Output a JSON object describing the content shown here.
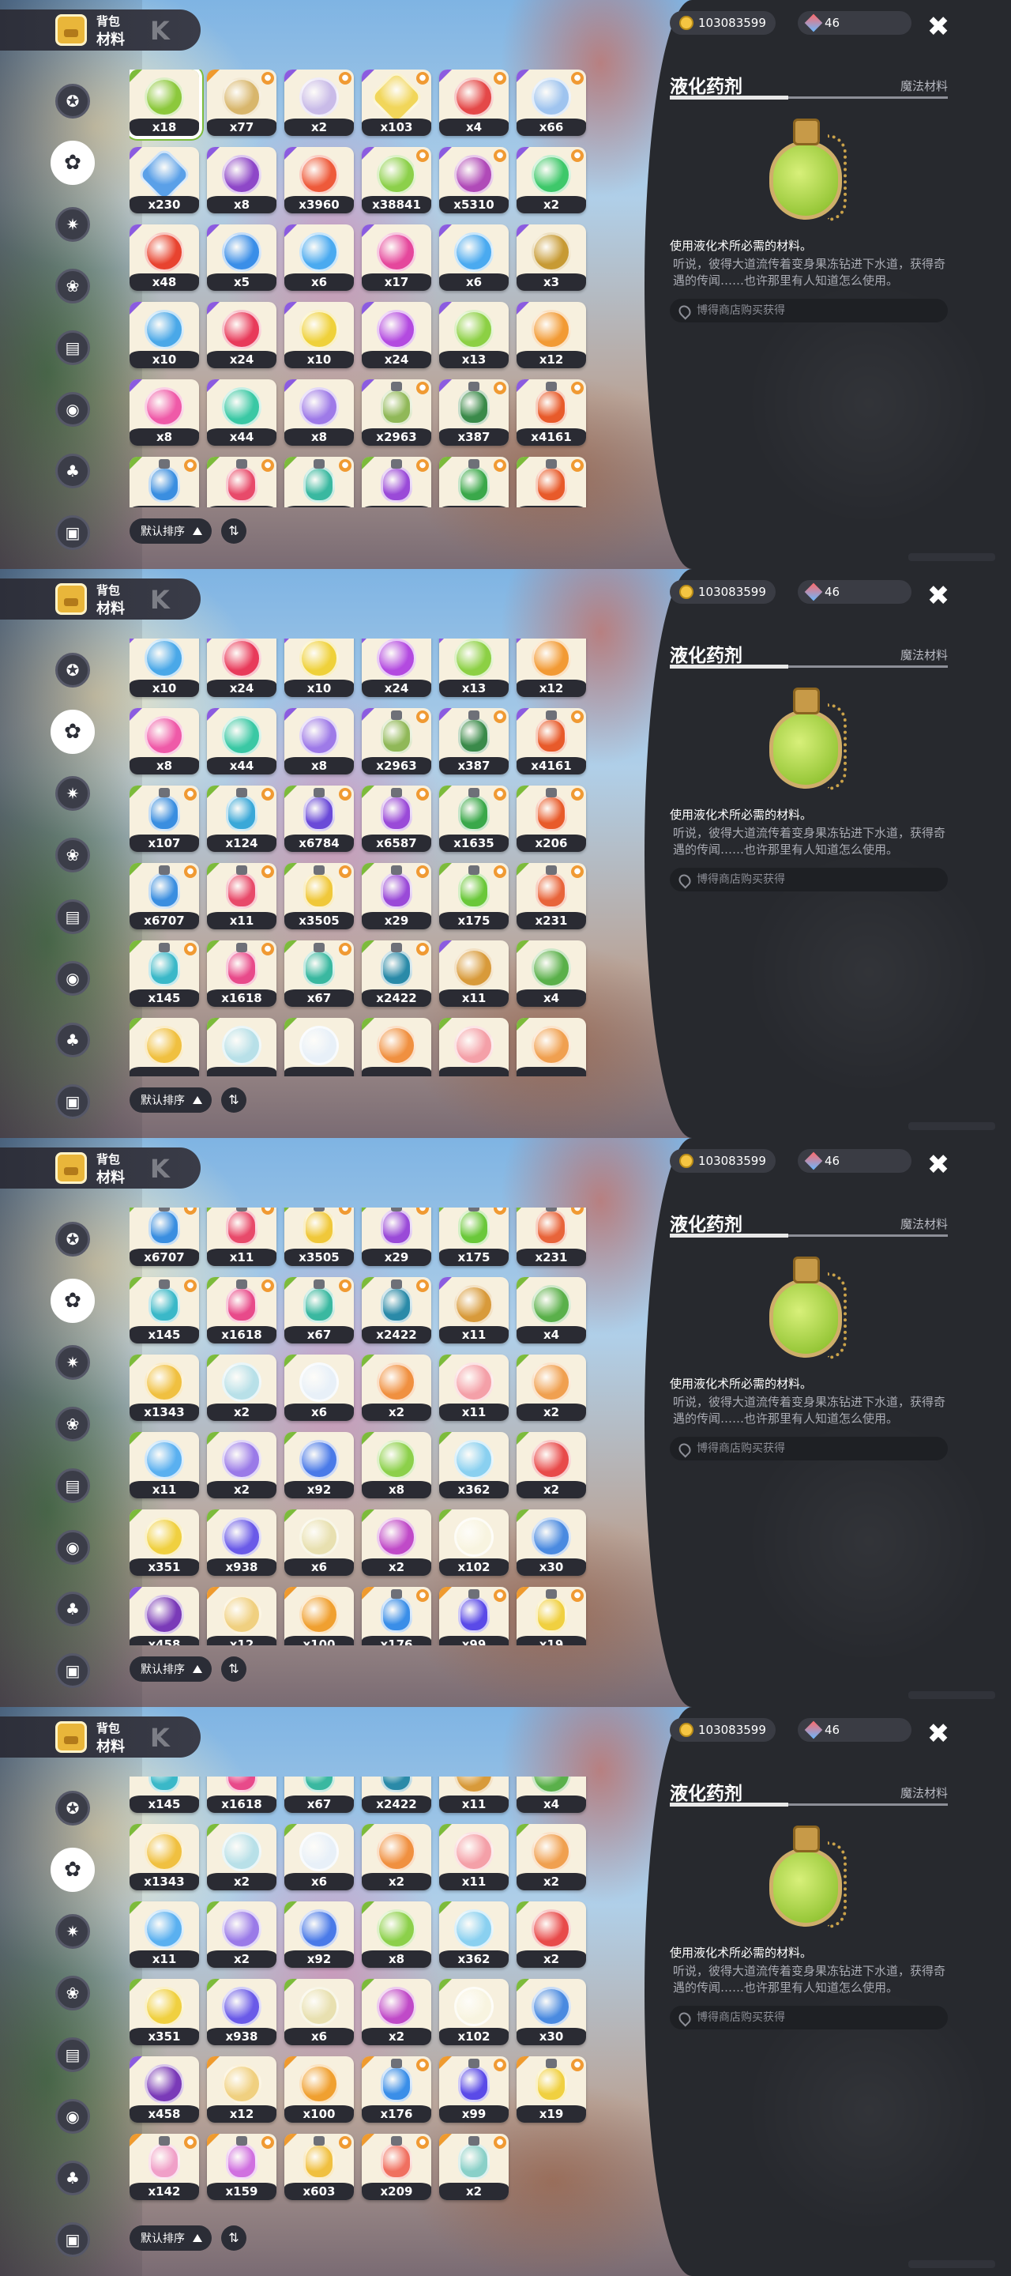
{
  "header": {
    "line1": "背包",
    "line2": "材料",
    "deco": "K"
  },
  "currency": {
    "coins": "103083599",
    "gems": "46"
  },
  "detail": {
    "title": "液化药剂",
    "category": "魔法材料",
    "use": "使用液化术所必需的材料。",
    "flavor": "听说，彼得大道流传着变身果冻钻进下水道，获得奇遇的传闻……也许那里有人知道怎么使用。",
    "source": "博得商店购买获得"
  },
  "sort": {
    "label": "默认排序",
    "toggle": "⇅"
  },
  "colors": {
    "rare_green": "#7cbb3b",
    "rare_purple": "#8b5be0",
    "rare_orange": "#ef9a2e",
    "new_badge": "#f09a33"
  },
  "sidebar": [
    "star-icon",
    "leaf-icon",
    "gear-star-icon",
    "flower-icon",
    "cart-icon",
    "ball-icon",
    "acorn-icon",
    "chest-icon"
  ],
  "panels": [
    {
      "active_sidebar": 1,
      "rows": [
        [
          [
            "x18",
            "#8cc83c",
            "g",
            0,
            "round"
          ],
          [
            "x77",
            "#d8b66c",
            "o",
            1,
            "round"
          ],
          [
            "x2",
            "#c9bbe8",
            "p",
            1,
            "round"
          ],
          [
            "x103",
            "#f1d65a",
            "p",
            1,
            "sq"
          ],
          [
            "x4",
            "#e44848",
            "p",
            1,
            "round"
          ],
          [
            "x66",
            "#9fc4ef",
            "p",
            1,
            "round"
          ]
        ],
        [
          [
            "x230",
            "#5aa0e8",
            "p",
            0,
            "sq"
          ],
          [
            "x8",
            "#8e47c8",
            "p",
            0,
            "round"
          ],
          [
            "x3960",
            "#ee5a3a",
            "p",
            0,
            "round"
          ],
          [
            "x38841",
            "#8cd04a",
            "p",
            1,
            "round"
          ],
          [
            "x5310",
            "#b04ab8",
            "p",
            1,
            "round"
          ],
          [
            "x2",
            "#3ec86a",
            "p",
            1,
            "round"
          ]
        ],
        [
          [
            "x48",
            "#e8432f",
            "p",
            0,
            "round"
          ],
          [
            "x5",
            "#3a8ee8",
            "p",
            0,
            "round"
          ],
          [
            "x6",
            "#4aaaf0",
            "p",
            0,
            "round"
          ],
          [
            "x17",
            "#e5479c",
            "p",
            0,
            "round"
          ],
          [
            "x6",
            "#4aaaf0",
            "p",
            0,
            "round"
          ],
          [
            "x3",
            "#c79a34",
            "p",
            0,
            "round"
          ]
        ],
        [
          [
            "x10",
            "#4aa8e8",
            "p",
            0,
            "round"
          ],
          [
            "x24",
            "#e83a5a",
            "p",
            0,
            "round"
          ],
          [
            "x10",
            "#efd13a",
            "p",
            0,
            "round"
          ],
          [
            "x24",
            "#b34ae0",
            "p",
            0,
            "round"
          ],
          [
            "x13",
            "#8cd044",
            "p",
            0,
            "round"
          ],
          [
            "x12",
            "#f29a34",
            "p",
            0,
            "round"
          ]
        ],
        [
          [
            "x8",
            "#ef5aa8",
            "p",
            0,
            "round"
          ],
          [
            "x44",
            "#3ac8a4",
            "p",
            0,
            "round"
          ],
          [
            "x8",
            "#9e7ae8",
            "p",
            0,
            "round"
          ],
          [
            "x2963",
            "#90b858",
            "p",
            1,
            "bottle"
          ],
          [
            "x387",
            "#3a8a4a",
            "p",
            1,
            "bottle"
          ],
          [
            "x4161",
            "#e85a2a",
            "p",
            1,
            "bottle"
          ]
        ],
        [
          [
            "",
            "#3a8ee0",
            "g",
            1,
            "bottle"
          ],
          [
            "",
            "#e84a6a",
            "g",
            1,
            "bottle"
          ],
          [
            "",
            "#3ab8a0",
            "g",
            1,
            "bottle"
          ],
          [
            "",
            "#9a4ad8",
            "g",
            1,
            "bottle"
          ],
          [
            "",
            "#3aa84a",
            "g",
            1,
            "bottle"
          ],
          [
            "",
            "#e85a2a",
            "g",
            1,
            "bottle"
          ]
        ]
      ]
    },
    {
      "active_sidebar": 1,
      "rows": [
        [
          [
            "x10",
            "#4aa8e8",
            "p",
            0,
            "round"
          ],
          [
            "x24",
            "#e83a5a",
            "p",
            0,
            "round"
          ],
          [
            "x10",
            "#efd13a",
            "p",
            0,
            "round"
          ],
          [
            "x24",
            "#b34ae0",
            "p",
            0,
            "round"
          ],
          [
            "x13",
            "#8cd044",
            "p",
            0,
            "round"
          ],
          [
            "x12",
            "#f29a34",
            "p",
            0,
            "round"
          ]
        ],
        [
          [
            "x8",
            "#ef5aa8",
            "p",
            0,
            "round"
          ],
          [
            "x44",
            "#3ac8a4",
            "p",
            0,
            "round"
          ],
          [
            "x8",
            "#9e7ae8",
            "p",
            0,
            "round"
          ],
          [
            "x2963",
            "#90b858",
            "p",
            1,
            "bottle"
          ],
          [
            "x387",
            "#3a8a4a",
            "p",
            1,
            "bottle"
          ],
          [
            "x4161",
            "#e85a2a",
            "p",
            1,
            "bottle"
          ]
        ],
        [
          [
            "x107",
            "#3a8ee0",
            "g",
            1,
            "bottle"
          ],
          [
            "x124",
            "#3aa8d8",
            "g",
            1,
            "bottle"
          ],
          [
            "x6784",
            "#6a4ad8",
            "g",
            1,
            "bottle"
          ],
          [
            "x6587",
            "#9a4ad8",
            "g",
            1,
            "bottle"
          ],
          [
            "x1635",
            "#3aa84a",
            "g",
            1,
            "bottle"
          ],
          [
            "x206",
            "#e85a2a",
            "g",
            1,
            "bottle"
          ]
        ],
        [
          [
            "x6707",
            "#3a8ee0",
            "g",
            1,
            "bottle"
          ],
          [
            "x11",
            "#e84a6a",
            "g",
            1,
            "bottle"
          ],
          [
            "x3505",
            "#f0c83a",
            "g",
            1,
            "bottle"
          ],
          [
            "x29",
            "#9a4ad8",
            "g",
            1,
            "bottle"
          ],
          [
            "x175",
            "#6ac83a",
            "g",
            1,
            "bottle"
          ],
          [
            "x231",
            "#e8643a",
            "g",
            1,
            "bottle"
          ]
        ],
        [
          [
            "x145",
            "#3ab8c8",
            "g",
            1,
            "bottle"
          ],
          [
            "x1618",
            "#e84a8a",
            "g",
            1,
            "bottle"
          ],
          [
            "x67",
            "#3ab8a0",
            "g",
            1,
            "bottle"
          ],
          [
            "x2422",
            "#2a8aa8",
            "g",
            1,
            "bottle"
          ],
          [
            "x11",
            "#d89a3a",
            "p",
            0,
            "round"
          ],
          [
            "x4",
            "#5ab04a",
            "g",
            0,
            "round"
          ]
        ],
        [
          [
            "",
            "#f0c040",
            "g",
            0,
            "round"
          ],
          [
            "",
            "#b8e0e8",
            "g",
            0,
            "round"
          ],
          [
            "",
            "#e8f0f8",
            "g",
            0,
            "round"
          ],
          [
            "",
            "#f09040",
            "g",
            0,
            "round"
          ],
          [
            "",
            "#f4a0a8",
            "g",
            0,
            "round"
          ],
          [
            "",
            "#f0a050",
            "g",
            0,
            "round"
          ]
        ]
      ]
    },
    {
      "active_sidebar": 1,
      "rows": [
        [
          [
            "x6707",
            "#3a8ee0",
            "g",
            1,
            "bottle"
          ],
          [
            "x11",
            "#e84a6a",
            "g",
            1,
            "bottle"
          ],
          [
            "x3505",
            "#f0c83a",
            "g",
            1,
            "bottle"
          ],
          [
            "x29",
            "#9a4ad8",
            "g",
            1,
            "bottle"
          ],
          [
            "x175",
            "#6ac83a",
            "g",
            1,
            "bottle"
          ],
          [
            "x231",
            "#e8643a",
            "g",
            1,
            "bottle"
          ]
        ],
        [
          [
            "x145",
            "#3ab8c8",
            "g",
            1,
            "bottle"
          ],
          [
            "x1618",
            "#e84a8a",
            "g",
            1,
            "bottle"
          ],
          [
            "x67",
            "#3ab8a0",
            "g",
            1,
            "bottle"
          ],
          [
            "x2422",
            "#2a8aa8",
            "g",
            1,
            "bottle"
          ],
          [
            "x11",
            "#d89a3a",
            "p",
            0,
            "round"
          ],
          [
            "x4",
            "#5ab04a",
            "g",
            0,
            "round"
          ]
        ],
        [
          [
            "x1343",
            "#f0c040",
            "g",
            0,
            "round"
          ],
          [
            "x2",
            "#b8e0e8",
            "g",
            0,
            "round"
          ],
          [
            "x6",
            "#e8f0f8",
            "g",
            0,
            "round"
          ],
          [
            "x2",
            "#f09040",
            "g",
            0,
            "round"
          ],
          [
            "x11",
            "#f4a0a8",
            "g",
            0,
            "round"
          ],
          [
            "x2",
            "#f0a050",
            "g",
            0,
            "round"
          ]
        ],
        [
          [
            "x11",
            "#5ab0f0",
            "g",
            0,
            "round"
          ],
          [
            "x2",
            "#9a7ae8",
            "g",
            0,
            "round"
          ],
          [
            "x92",
            "#4a7ae8",
            "g",
            0,
            "round"
          ],
          [
            "x8",
            "#8cd04a",
            "g",
            0,
            "round"
          ],
          [
            "x362",
            "#8ad0f0",
            "g",
            0,
            "round"
          ],
          [
            "x2",
            "#e84a4a",
            "g",
            0,
            "round"
          ]
        ],
        [
          [
            "x351",
            "#f0d040",
            "g",
            0,
            "round"
          ],
          [
            "x938",
            "#6a5ae8",
            "g",
            0,
            "round"
          ],
          [
            "x6",
            "#e8e0b0",
            "g",
            0,
            "round"
          ],
          [
            "x2",
            "#c04ac8",
            "g",
            0,
            "round"
          ],
          [
            "x102",
            "#f8f4e0",
            "g",
            0,
            "round"
          ],
          [
            "x30",
            "#4a8ae0",
            "g",
            0,
            "round"
          ]
        ],
        [
          [
            "x458",
            "#7a3ab8",
            "p",
            0,
            "round"
          ],
          [
            "x12",
            "#f0d080",
            "o",
            0,
            "round"
          ],
          [
            "x100",
            "#f0a030",
            "o",
            0,
            "round"
          ],
          [
            "x176",
            "#3a8ee8",
            "o",
            1,
            "bottle"
          ],
          [
            "x99",
            "#5a4ae8",
            "o",
            1,
            "bottle"
          ],
          [
            "x19",
            "#f0d040",
            "o",
            1,
            "bottle"
          ]
        ]
      ]
    },
    {
      "active_sidebar": 1,
      "rows": [
        [
          [
            "x145",
            "#3ab8c8",
            "g",
            1,
            "bottle"
          ],
          [
            "x1618",
            "#e84a8a",
            "g",
            1,
            "bottle"
          ],
          [
            "x67",
            "#3ab8a0",
            "g",
            1,
            "bottle"
          ],
          [
            "x2422",
            "#2a8aa8",
            "g",
            1,
            "bottle"
          ],
          [
            "x11",
            "#d89a3a",
            "p",
            0,
            "round"
          ],
          [
            "x4",
            "#5ab04a",
            "g",
            0,
            "round"
          ]
        ],
        [
          [
            "x1343",
            "#f0c040",
            "g",
            0,
            "round"
          ],
          [
            "x2",
            "#b8e0e8",
            "g",
            0,
            "round"
          ],
          [
            "x6",
            "#e8f0f8",
            "g",
            0,
            "round"
          ],
          [
            "x2",
            "#f09040",
            "g",
            0,
            "round"
          ],
          [
            "x11",
            "#f4a0a8",
            "g",
            0,
            "round"
          ],
          [
            "x2",
            "#f0a050",
            "g",
            0,
            "round"
          ]
        ],
        [
          [
            "x11",
            "#5ab0f0",
            "g",
            0,
            "round"
          ],
          [
            "x2",
            "#9a7ae8",
            "g",
            0,
            "round"
          ],
          [
            "x92",
            "#4a7ae8",
            "g",
            0,
            "round"
          ],
          [
            "x8",
            "#8cd04a",
            "g",
            0,
            "round"
          ],
          [
            "x362",
            "#8ad0f0",
            "g",
            0,
            "round"
          ],
          [
            "x2",
            "#e84a4a",
            "g",
            0,
            "round"
          ]
        ],
        [
          [
            "x351",
            "#f0d040",
            "g",
            0,
            "round"
          ],
          [
            "x938",
            "#6a5ae8",
            "g",
            0,
            "round"
          ],
          [
            "x6",
            "#e8e0b0",
            "g",
            0,
            "round"
          ],
          [
            "x2",
            "#c04ac8",
            "g",
            0,
            "round"
          ],
          [
            "x102",
            "#f8f4e0",
            "g",
            0,
            "round"
          ],
          [
            "x30",
            "#4a8ae0",
            "g",
            0,
            "round"
          ]
        ],
        [
          [
            "x458",
            "#7a3ab8",
            "p",
            0,
            "round"
          ],
          [
            "x12",
            "#f0d080",
            "o",
            0,
            "round"
          ],
          [
            "x100",
            "#f0a030",
            "o",
            0,
            "round"
          ],
          [
            "x176",
            "#3a8ee8",
            "o",
            1,
            "bottle"
          ],
          [
            "x99",
            "#5a4ae8",
            "o",
            1,
            "bottle"
          ],
          [
            "x19",
            "#f0d040",
            "o",
            1,
            "bottle"
          ]
        ],
        [
          [
            "x142",
            "#f0a0c8",
            "o",
            1,
            "bottle"
          ],
          [
            "x159",
            "#d070e0",
            "o",
            1,
            "bottle"
          ],
          [
            "x603",
            "#f0c040",
            "o",
            1,
            "bottle"
          ],
          [
            "x209",
            "#f07060",
            "o",
            1,
            "bottle"
          ],
          [
            "x2",
            "#8ad0c8",
            "o",
            1,
            "bottle"
          ]
        ]
      ]
    }
  ]
}
